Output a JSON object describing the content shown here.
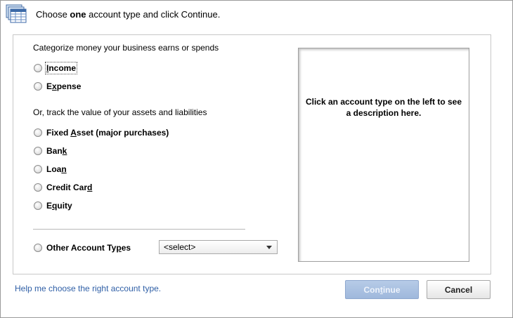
{
  "header": {
    "prefix": "Choose ",
    "emphasis": "one",
    "suffix": " account type and click Continue."
  },
  "categorize": {
    "label": "Categorize money your business earns or spends",
    "options": [
      {
        "pre": "",
        "key": "I",
        "post": "ncome"
      },
      {
        "pre": "E",
        "key": "x",
        "post": "pense"
      }
    ]
  },
  "track": {
    "label": "Or, track the value of your assets and liabilities",
    "options": [
      {
        "pre": "Fixed ",
        "key": "A",
        "post": "sset (major purchases)"
      },
      {
        "pre": "Ban",
        "key": "k",
        "post": ""
      },
      {
        "pre": "Loa",
        "key": "n",
        "post": ""
      },
      {
        "pre": "Credit Car",
        "key": "d",
        "post": ""
      },
      {
        "pre": "E",
        "key": "q",
        "post": "uity"
      }
    ]
  },
  "other": {
    "pre": "Other Account Ty",
    "key": "p",
    "post": "es",
    "select_value": "<select>"
  },
  "description": "Click an account type on the left to see a description here.",
  "help_link": "Help me choose the right account type.",
  "buttons": {
    "continue_pre": "Con",
    "continue_key": "t",
    "continue_post": "inue",
    "cancel": "Cancel"
  }
}
